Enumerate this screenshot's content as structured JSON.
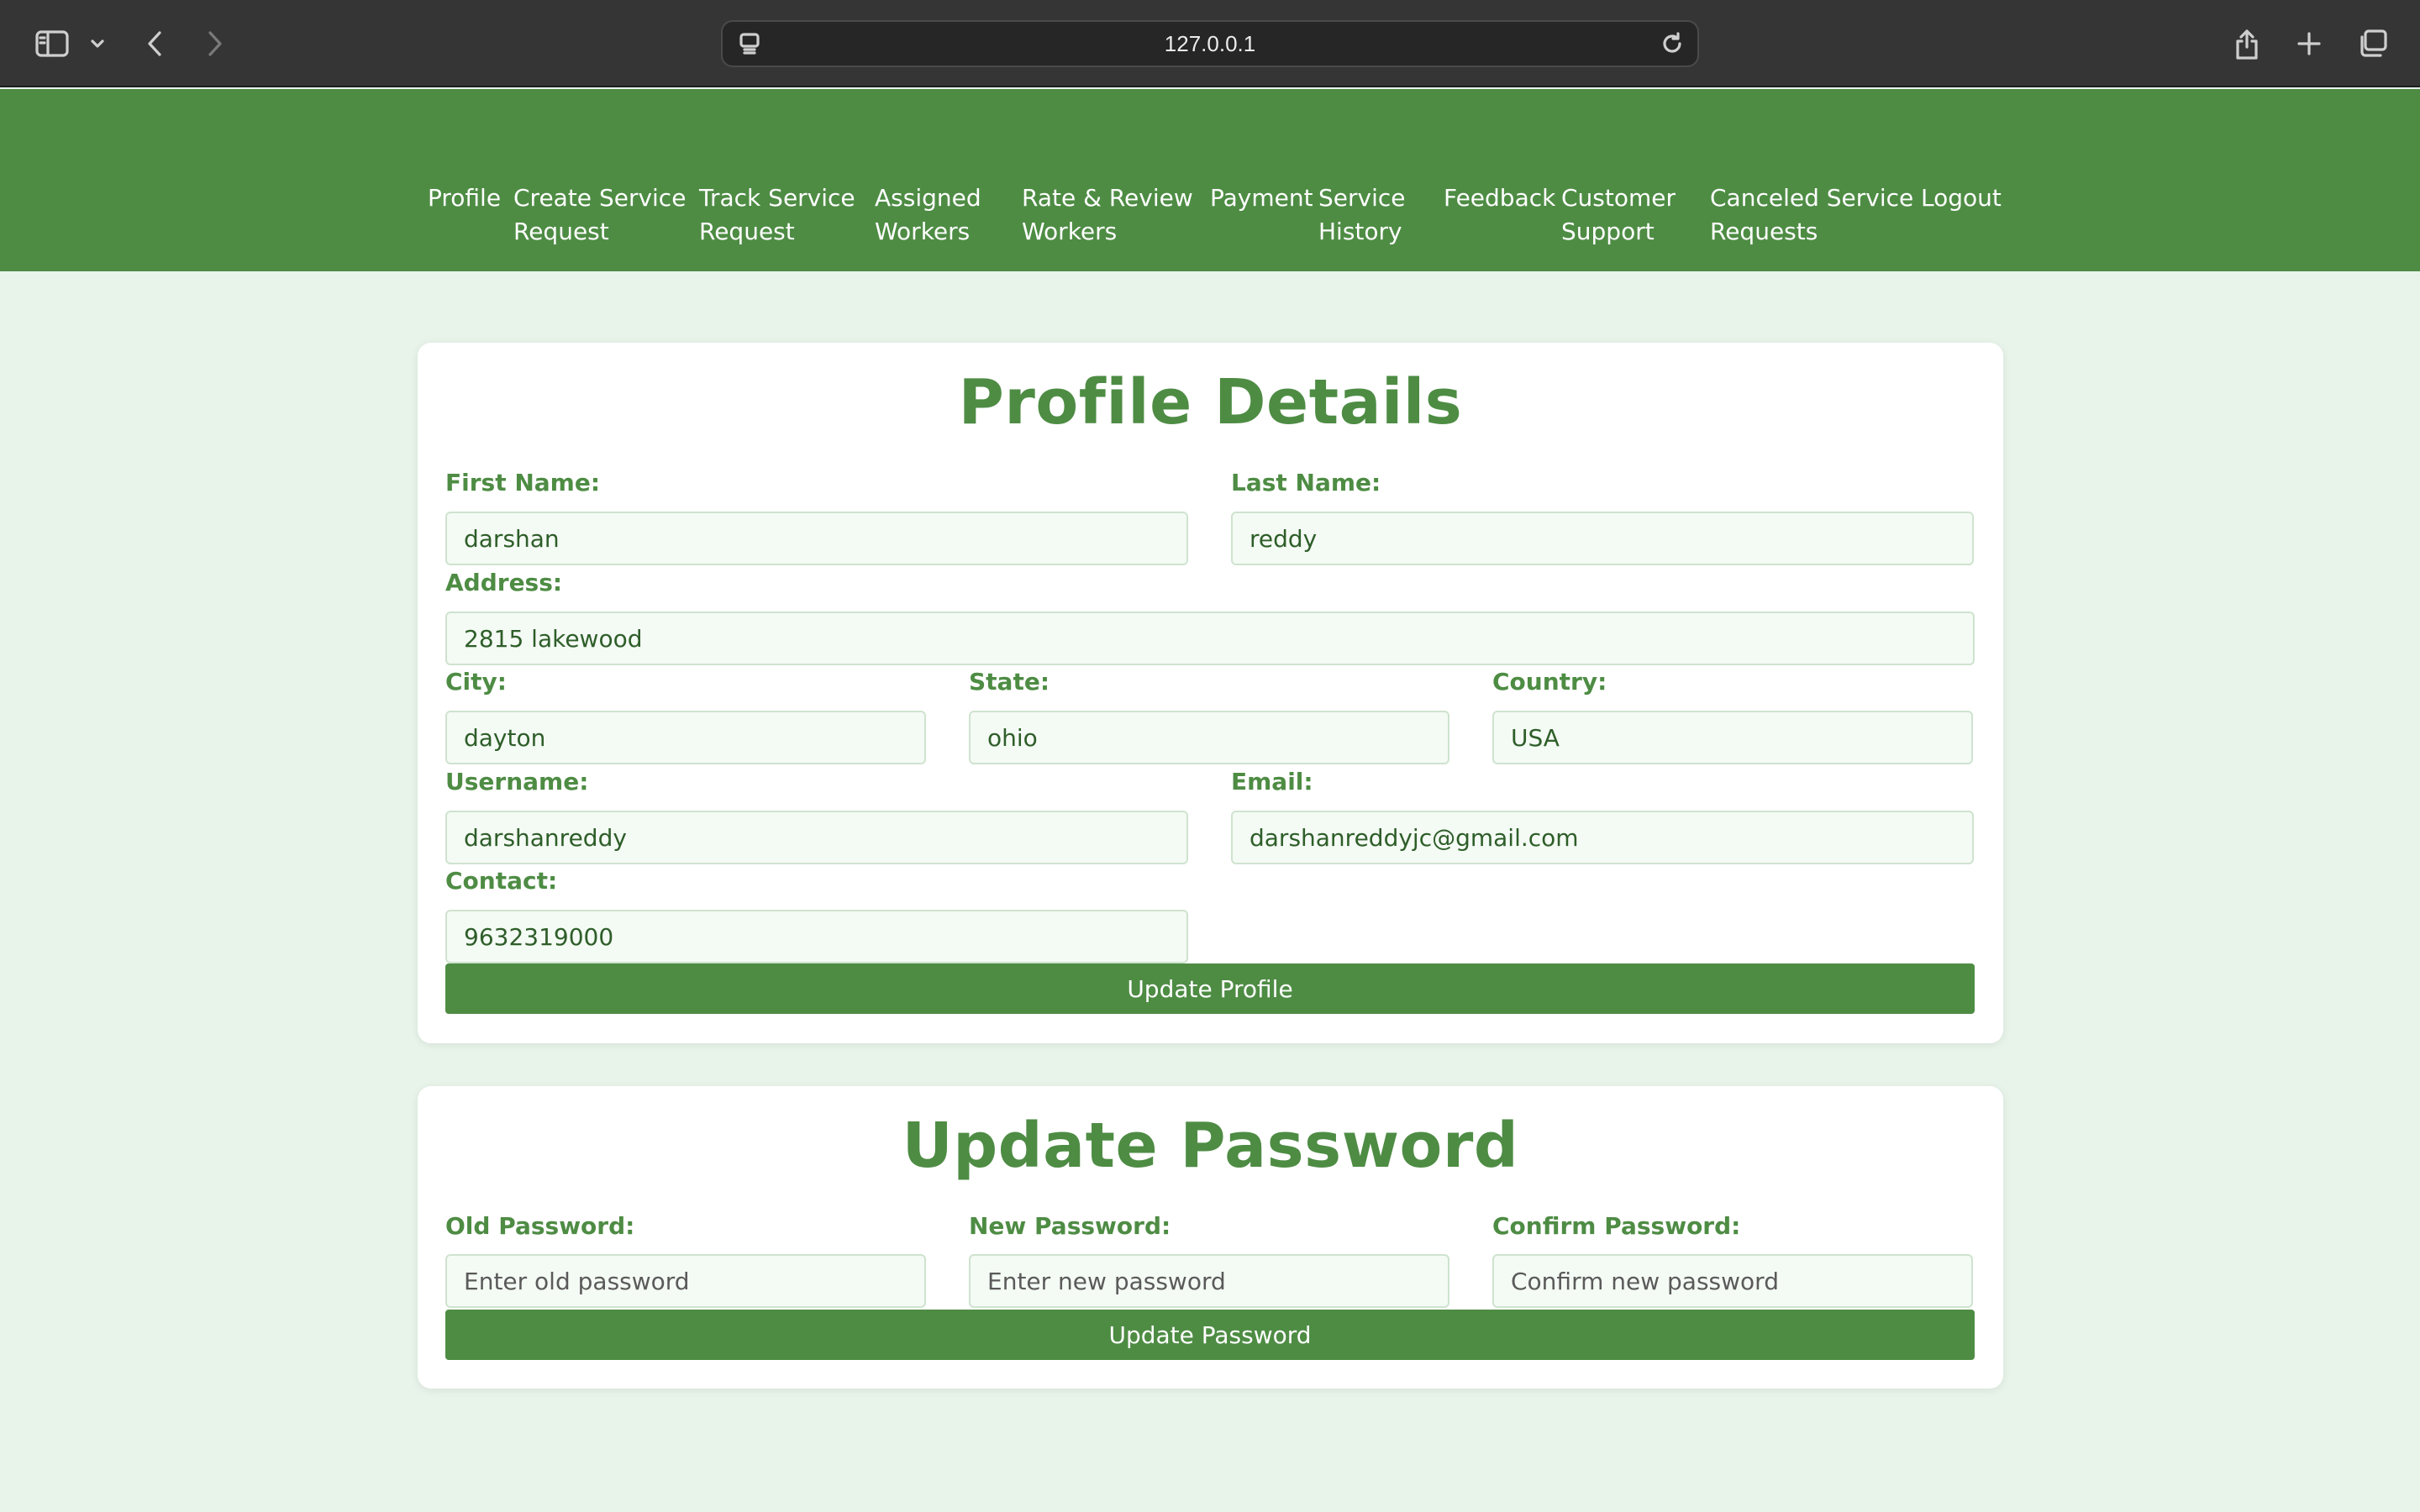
{
  "browser": {
    "url": "127.0.0.1",
    "icons": [
      "sidebar-icon",
      "chevron-down-icon",
      "back-icon",
      "forward-icon",
      "site-settings-icon",
      "reload-icon",
      "share-icon",
      "new-tab-icon",
      "tabs-overview-icon"
    ]
  },
  "nav": {
    "items": [
      {
        "label": "Profile"
      },
      {
        "label": "Create Service\nRequest"
      },
      {
        "label": "Track Service\nRequest"
      },
      {
        "label": "Assigned\nWorkers"
      },
      {
        "label": "Rate & Review\nWorkers"
      },
      {
        "label": "Payment"
      },
      {
        "label": "Service\nHistory"
      },
      {
        "label": "Feedback"
      },
      {
        "label": "Customer\nSupport"
      },
      {
        "label": "Canceled Service\nRequests"
      },
      {
        "label": "Logout"
      }
    ]
  },
  "profile": {
    "title": "Profile Details",
    "first_name": {
      "label": "First Name:",
      "value": "darshan"
    },
    "last_name": {
      "label": "Last Name:",
      "value": "reddy"
    },
    "address": {
      "label": "Address:",
      "value": "2815 lakewood"
    },
    "city": {
      "label": "City:",
      "value": "dayton"
    },
    "state": {
      "label": "State:",
      "value": "ohio"
    },
    "country": {
      "label": "Country:",
      "value": "USA"
    },
    "username": {
      "label": "Username:",
      "value": "darshanreddy"
    },
    "email": {
      "label": "Email:",
      "value": "darshanreddyjc@gmail.com"
    },
    "contact": {
      "label": "Contact:",
      "value": "9632319000"
    },
    "update_button": "Update Profile"
  },
  "password": {
    "title": "Update Password",
    "old": {
      "label": "Old Password:",
      "placeholder": "Enter old password"
    },
    "new": {
      "label": "New Password:",
      "placeholder": "Enter new password"
    },
    "confirm": {
      "label": "Confirm Password:",
      "placeholder": "Confirm new password"
    },
    "update_button": "Update Password"
  },
  "colors": {
    "primary_green": "#4e8c44",
    "page_background": "#e8f4ea",
    "input_background": "#f4faf4",
    "browser_chrome": "#353535"
  }
}
